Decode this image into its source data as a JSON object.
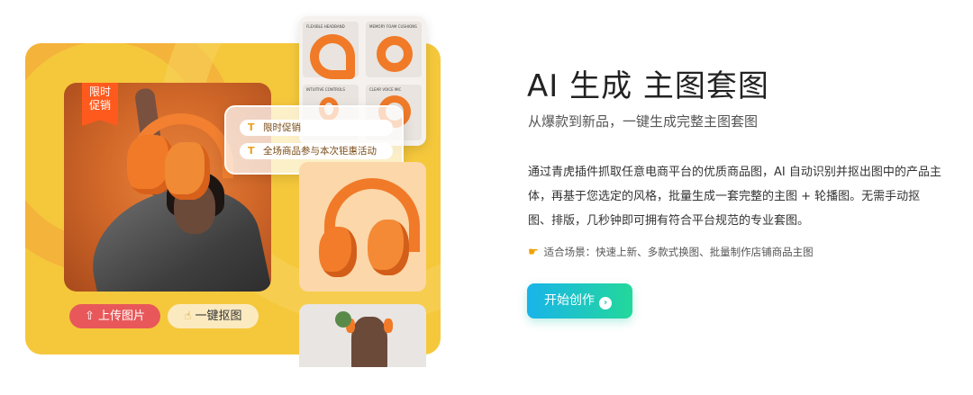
{
  "hero": {
    "badge_text": "限时\n促销",
    "promo_rows": [
      "限时促销",
      "全场商品参与本次钜惠活动"
    ],
    "upload_button": "上传图片",
    "matting_button": "一键抠图",
    "mini_labels": [
      "FLEXIBLE HEADBAND",
      "MEMORY FOAM CUSHIONS",
      "INTUITIVE CONTROLS",
      "CLEAR VOICE MIC"
    ]
  },
  "content": {
    "title": "AI 生成 主图套图",
    "subtitle": "从爆款到新品，一键生成完整主图套图",
    "description": "通过青虎插件抓取任意电商平台的优质商品图，AI 自动识别并抠出图中的产品主体，再基于您选定的风格，批量生成一套完整的主图 + 轮播图。无需手动抠图、排版，几秒钟即可拥有符合平台规范的专业套图。",
    "scenario": "适合场景：快速上新、多款式换图、批量制作店铺商品主图",
    "cta_label": "开始创作"
  },
  "colors": {
    "hero_bg": "#f5c83c",
    "accent_orange": "#f07a28",
    "upload_red": "#e8585a",
    "cta_gradient_start": "#19b4ea",
    "cta_gradient_end": "#23d89a"
  },
  "icons": {
    "upload": "upload-icon",
    "matting": "cursor-click-icon",
    "scenario": "pointing-hand-icon",
    "cta": "arrow-right-circle-icon"
  }
}
